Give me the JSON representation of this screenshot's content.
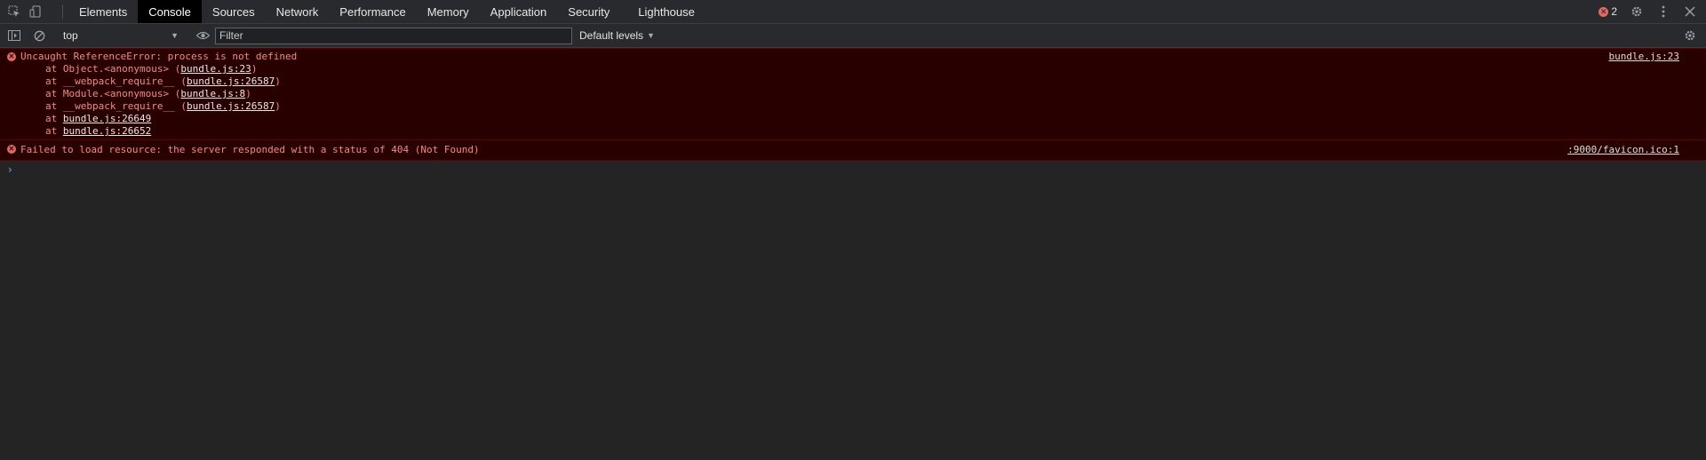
{
  "tabs": [
    "Elements",
    "Console",
    "Sources",
    "Network",
    "Performance",
    "Memory",
    "Application",
    "Security",
    "Lighthouse"
  ],
  "active_tab": "Console",
  "error_badge": "2",
  "context": "top",
  "filter": {
    "placeholder": "Filter",
    "value": ""
  },
  "levels_label": "Default levels",
  "messages": {
    "m1": {
      "text": "Uncaught ReferenceError: process is not defined",
      "source": "bundle.js:23",
      "frames": [
        {
          "prefix": "at Object.<anonymous> (",
          "link": "bundle.js:23",
          "suffix": ")"
        },
        {
          "prefix": "at __webpack_require__ (",
          "link": "bundle.js:26587",
          "suffix": ")"
        },
        {
          "prefix": "at Module.<anonymous> (",
          "link": "bundle.js:8",
          "suffix": ")"
        },
        {
          "prefix": "at __webpack_require__ (",
          "link": "bundle.js:26587",
          "suffix": ")"
        },
        {
          "prefix": "at ",
          "link": "bundle.js:26649",
          "suffix": ""
        },
        {
          "prefix": "at ",
          "link": "bundle.js:26652",
          "suffix": ""
        }
      ]
    },
    "m2": {
      "text": "Failed to load resource: the server responded with a status of 404 (Not Found)",
      "source": ":9000/favicon.ico:1"
    }
  },
  "prompt_symbol": "›",
  "colors": {
    "error_bg": "#290000",
    "error_text": "#f28b82",
    "active_tab_bg": "#000000"
  },
  "icons": [
    "inspect-element-icon",
    "device-toolbar-icon",
    "sidebar-toggle-icon",
    "clear-console-icon",
    "eye-icon",
    "gear-icon",
    "more-vert-icon",
    "close-icon",
    "error-icon"
  ]
}
